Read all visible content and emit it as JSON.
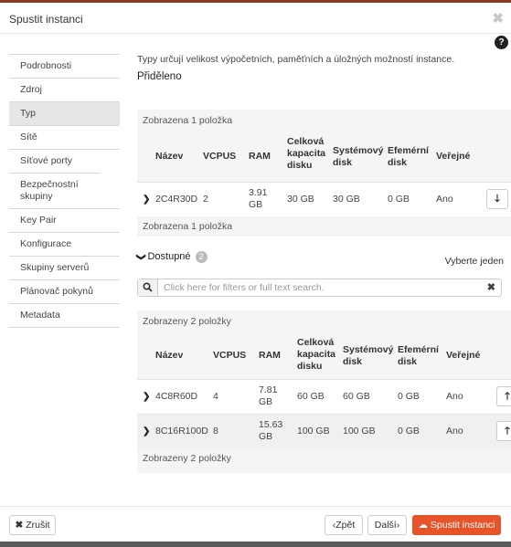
{
  "dialog": {
    "title": "Spustit instanci"
  },
  "nav": {
    "items": [
      "Podrobnosti",
      "Zdroj",
      "Typ",
      "Sítě",
      "Síťové porty",
      "Bezpečnostní skupiny",
      "Key Pair",
      "Konfigurace",
      "Skupiny serverů",
      "Plánovač pokynů",
      "Metadata"
    ],
    "active_index": 2
  },
  "main": {
    "description": "Typy určují velikost výpočetních, paměťních a úložných možností instance.",
    "allocated_title": "Přiděleno"
  },
  "allocated": {
    "count_text": "Zobrazena 1 položka",
    "columns": {
      "name": "Název",
      "vcpus": "VCPUS",
      "ram": "RAM",
      "disk1": "Celková",
      "disk2": "kapacita",
      "disk3": "disku",
      "root1": "Systémový",
      "root2": "disk",
      "eph1": "Efemérní",
      "eph2": "disk",
      "public": "Veřejné"
    },
    "rows": [
      {
        "name": "2C4R30D",
        "vcpus": "2",
        "ram1": "3.91",
        "ram2": "GB",
        "disk": "30 GB",
        "root": "30 GB",
        "eph": "0 GB",
        "public": "Ano"
      }
    ]
  },
  "available": {
    "label": "Dostupné",
    "count": "2",
    "pick_label": "Vyberte jeden",
    "search_placeholder": "Click here for filters or full text search.",
    "count_text": "Zobrazeny 2 položky",
    "rows": [
      {
        "name": "4C8R60D",
        "vcpus": "4",
        "ram1": "7.81",
        "ram2": "GB",
        "disk": "60 GB",
        "root": "60 GB",
        "eph": "0 GB",
        "public": "Ano"
      },
      {
        "name": "8C16R100D",
        "vcpus": "8",
        "ram1": "15.63",
        "ram2": "GB",
        "disk": "100 GB",
        "root": "100 GB",
        "eph": "0 GB",
        "public": "Ano"
      }
    ]
  },
  "footer": {
    "cancel": "Zrušit",
    "back": "Zpět",
    "next": "Další",
    "launch": "Spustit instanci"
  },
  "colors": {
    "primary": "#e8542a"
  }
}
